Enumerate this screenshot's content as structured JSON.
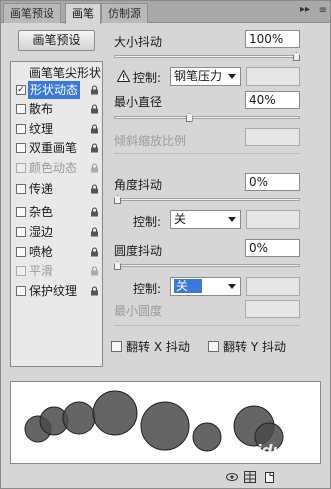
{
  "tabs": [
    "画笔预设",
    "画笔",
    "仿制源"
  ],
  "tab_menu_glyph": "▸▸",
  "tab_tail_glyph": "≡",
  "preset_button": "画笔预设",
  "list_header": "画笔笔尖形状",
  "list_items": [
    {
      "label": "形状动态",
      "checked": true,
      "selected": true,
      "disabled": false,
      "lock": true
    },
    {
      "label": "散布",
      "checked": false,
      "selected": false,
      "disabled": false,
      "lock": true
    },
    {
      "label": "纹理",
      "checked": false,
      "selected": false,
      "disabled": false,
      "lock": true
    },
    {
      "label": "双重画笔",
      "checked": false,
      "selected": false,
      "disabled": false,
      "lock": true
    },
    {
      "label": "颜色动态",
      "checked": false,
      "selected": false,
      "disabled": true,
      "lock": true
    },
    {
      "label": "传递",
      "checked": false,
      "selected": false,
      "disabled": false,
      "lock": true
    },
    {
      "label": "杂色",
      "checked": false,
      "selected": false,
      "disabled": false,
      "lock": true
    },
    {
      "label": "湿边",
      "checked": false,
      "selected": false,
      "disabled": false,
      "lock": true
    },
    {
      "label": "喷枪",
      "checked": false,
      "selected": false,
      "disabled": false,
      "lock": true
    },
    {
      "label": "平滑",
      "checked": false,
      "selected": false,
      "disabled": true,
      "lock": true
    },
    {
      "label": "保护纹理",
      "checked": false,
      "selected": false,
      "disabled": false,
      "lock": true
    }
  ],
  "size_jitter": {
    "label": "大小抖动",
    "value": "100%",
    "level": 1.0
  },
  "control1": {
    "label": "控制:",
    "value": "钢笔压力"
  },
  "min_diameter": {
    "label": "最小直径",
    "value": "40%",
    "level": 0.4
  },
  "tilt_scale": {
    "label": "倾斜缩放比例",
    "value": ""
  },
  "angle_jitter": {
    "label": "角度抖动",
    "value": "0%",
    "level": 0.0
  },
  "control2": {
    "label": "控制:",
    "value": "关"
  },
  "roundness_jitter": {
    "label": "圆度抖动",
    "value": "0%",
    "level": 0.0
  },
  "control3": {
    "label": "控制:",
    "value": "关"
  },
  "min_roundness": {
    "label": "最小圆度",
    "value": ""
  },
  "flip_x": {
    "label": "翻转 X 抖动",
    "checked": false
  },
  "flip_y": {
    "label": "翻转 Y 抖动",
    "checked": false
  },
  "watermark": "Baidu经验",
  "colors": {
    "selection": "#3a79d9",
    "panel": "#d6d6d6",
    "dab": "#4a4a4a"
  },
  "icons": [
    "lock-icon",
    "warning-icon",
    "eye-icon",
    "grid-icon",
    "new-page-icon"
  ]
}
